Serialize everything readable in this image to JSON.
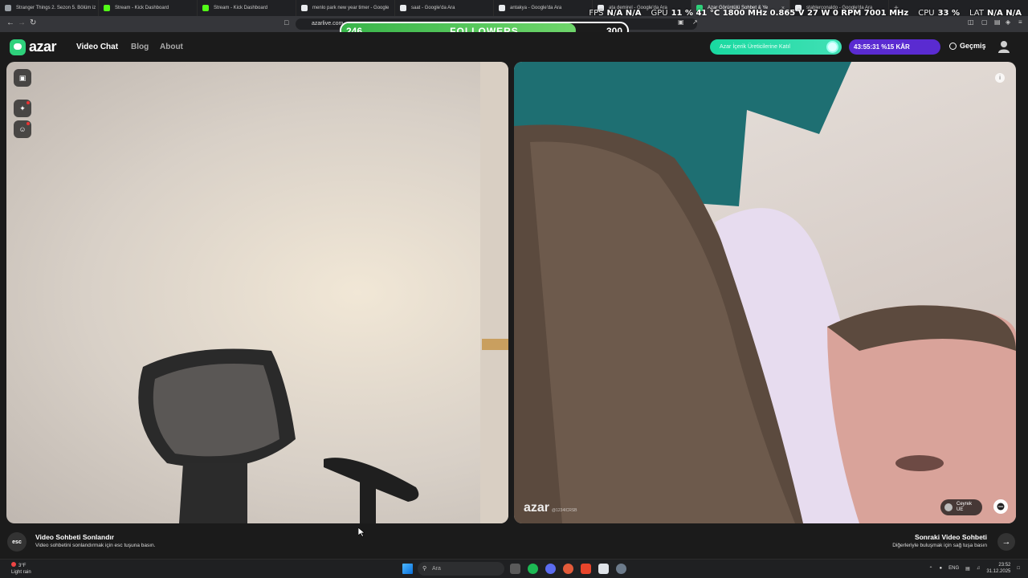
{
  "browser": {
    "tabs": [
      {
        "title": "Stranger Things 2. Sezon 5. Bölüm iz",
        "color": "#9aa0a6"
      },
      {
        "title": "Stream - Kick Dashboard",
        "color": "#53fc18"
      },
      {
        "title": "Stream - Kick Dashboard",
        "color": "#53fc18"
      },
      {
        "title": "menlo park new year timer - Google",
        "color": "#e8eaed"
      },
      {
        "title": "saat - Google'da Ara",
        "color": "#e8eaed"
      },
      {
        "title": "antakya - Google'da Ara",
        "color": "#e8eaed"
      },
      {
        "title": "ata demirel - Google'da Ara",
        "color": "#e8eaed"
      },
      {
        "title": "Azar Görüntülü Sohbet & Ye",
        "color": "#2ed17b",
        "active": true
      },
      {
        "title": "stablerconaldo - Google'da Ara",
        "color": "#e8eaed"
      }
    ],
    "url": "azarlive.com"
  },
  "overlay": {
    "fps_label": "FPS",
    "fps_value": "N/A",
    "fps_value2": "N/A",
    "gpu_label": "GPU",
    "gpu_text": "11 % 41 °C 1800 MHz 0.865 V 27 W 0 RPM 7001 MHz",
    "cpu_label": "CPU",
    "cpu_value": "33 %",
    "lat_label": "LAT",
    "lat_value": "N/A",
    "lat_value2": "N/A"
  },
  "followers": {
    "current": "246",
    "label": "FOLLOWERS",
    "goal": "300",
    "progress": 0.82
  },
  "site": {
    "logo_text": "azar",
    "nav": {
      "video_chat": "Video Chat",
      "blog": "Blog",
      "about": "About"
    },
    "promo_text": "Azar İçerik Üreticilerine Katıl",
    "timer_text": "43:55:31 %15 KÂR",
    "history_label": "Geçmiş"
  },
  "video": {
    "watermark": "azar",
    "watermark_handle": "@1234ICRSB",
    "partner_name": "Ceyrek",
    "partner_country": "UE"
  },
  "footer": {
    "esc_label": "esc",
    "end_title": "Video Sohbeti Sonlandır",
    "end_sub": "Video sohbetini sonlandırmak için esc tuşuna basın.",
    "next_title": "Sonraki Video Sohbeti",
    "next_sub": "Diğerleriyle buluşmak için sağ tuşa basın"
  },
  "taskbar": {
    "weather_temp": "3°F",
    "weather_desc": "Light rain",
    "search_placeholder": "Ara",
    "lang": "ENG",
    "time": "23:52",
    "date": "31.12.2025"
  },
  "colors": {
    "accent": "#2ed17b",
    "followers_fill": "#39b54a",
    "timer_bg": "#5a2bd1"
  }
}
